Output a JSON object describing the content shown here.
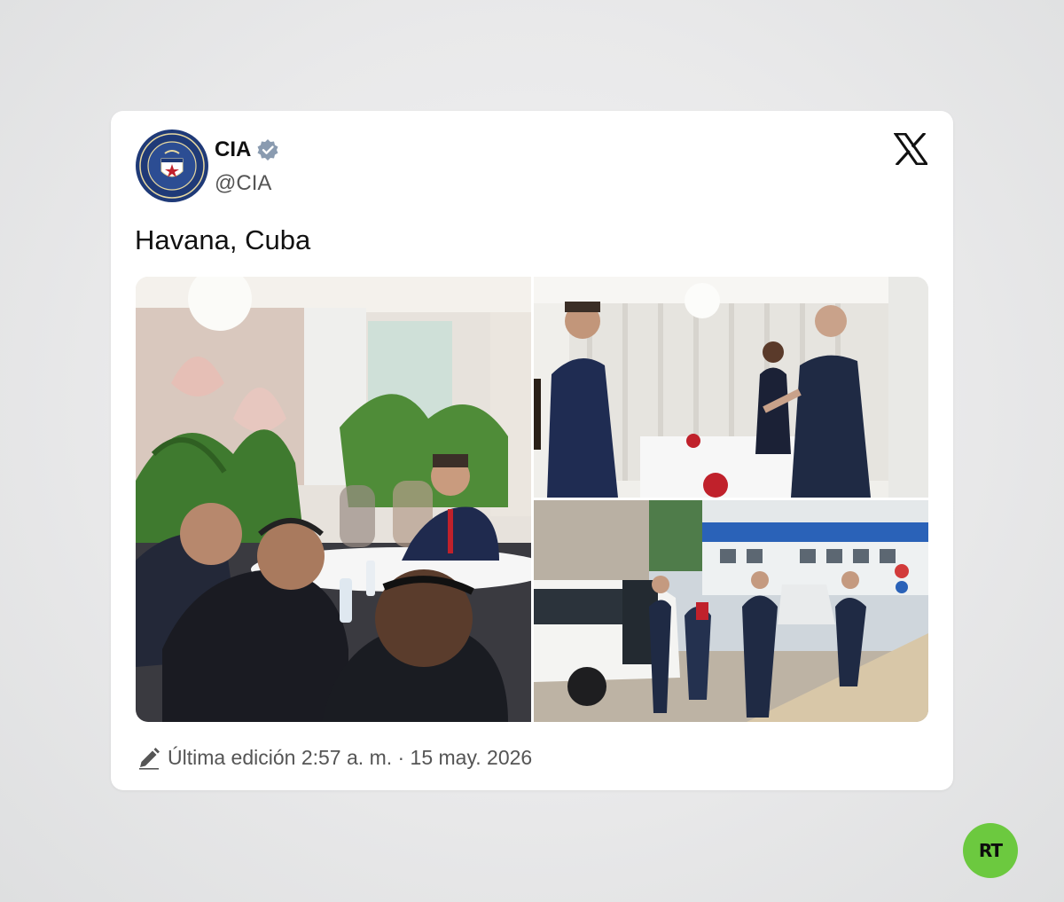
{
  "post": {
    "display_name": "CIA",
    "handle": "@CIA",
    "text": "Havana, Cuba",
    "edited_label": "Última edición 2:57 a. m. · 15 may. 2026",
    "media": [
      {
        "icon": "photo-meeting-table"
      },
      {
        "icon": "photo-handshake-greeting"
      },
      {
        "icon": "photo-street-vehicles"
      }
    ]
  },
  "icons": {
    "avatar": "cia-seal-logo",
    "verified": "verified-badge-icon",
    "platform": "x-logo-icon",
    "edit": "pencil-icon"
  },
  "watermark": {
    "text": "RT",
    "color": "#6cc93f"
  },
  "colors": {
    "verified": "#8a9bb0",
    "seal_blue": "#1f3a78"
  }
}
